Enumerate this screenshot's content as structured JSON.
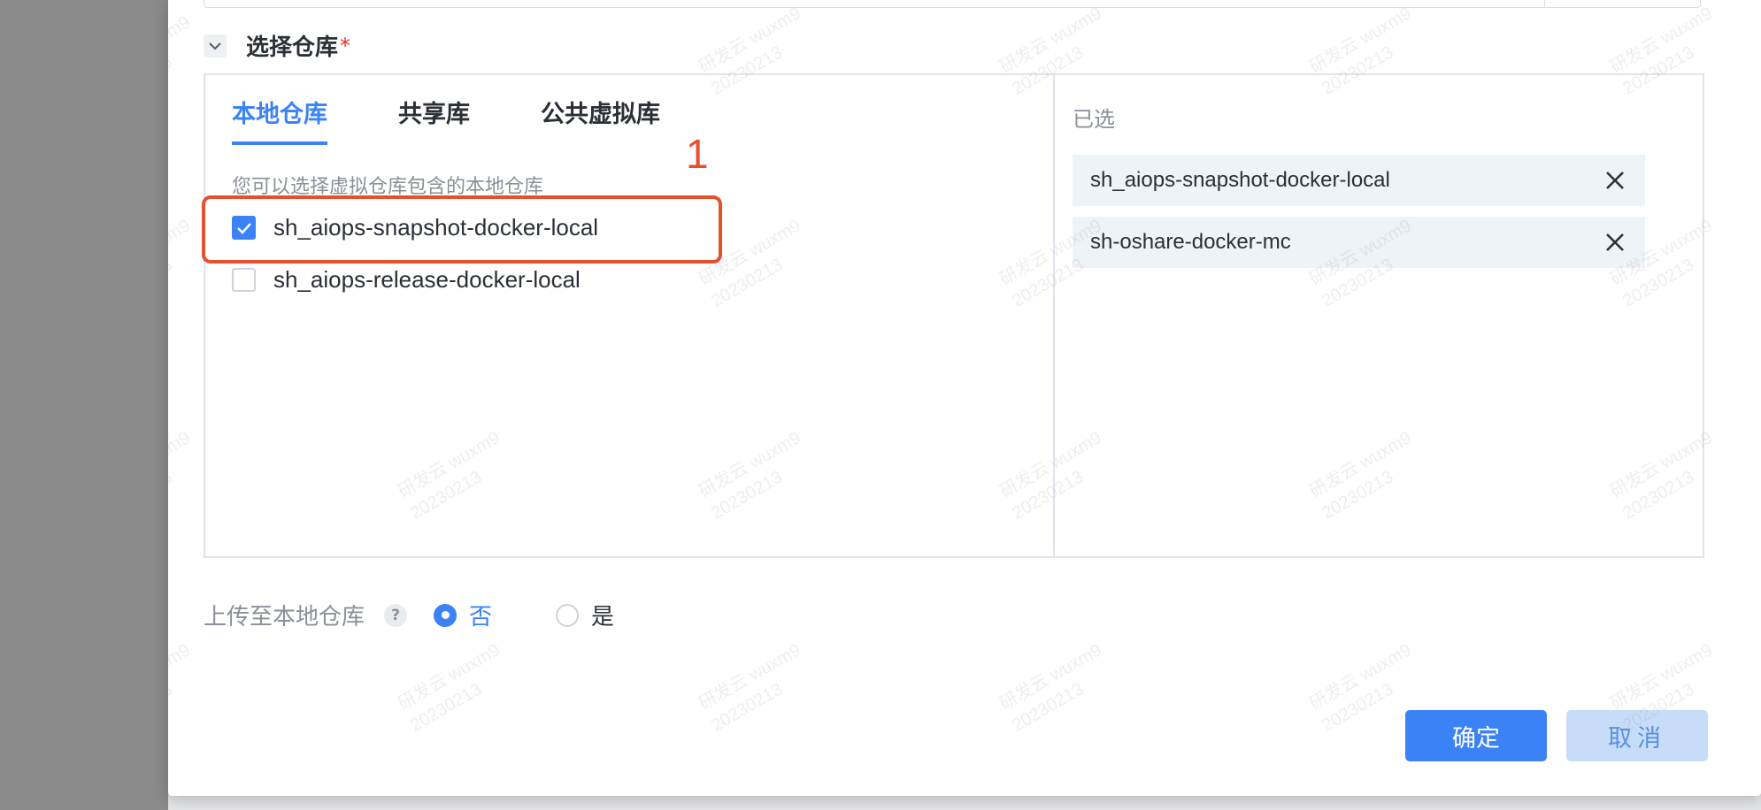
{
  "section": {
    "title": "选择仓库",
    "required_mark": "*"
  },
  "tabs": [
    {
      "label": "本地仓库",
      "active": true
    },
    {
      "label": "共享库",
      "active": false
    },
    {
      "label": "公共虚拟库",
      "active": false
    }
  ],
  "hint": "您可以选择虚拟仓库包含的本地仓库",
  "annotation": {
    "number": "1",
    "color": "#e5502d"
  },
  "local_repos": [
    {
      "label": "sh_aiops-snapshot-docker-local",
      "checked": true
    },
    {
      "label": "sh_aiops-release-docker-local",
      "checked": false
    }
  ],
  "selected": {
    "title": "已选",
    "items": [
      {
        "label": "sh_aiops-snapshot-docker-local"
      },
      {
        "label": "sh-oshare-docker-mc"
      }
    ]
  },
  "upload": {
    "label": "上传至本地仓库",
    "help_icon": "question-icon",
    "options": [
      {
        "label": "否",
        "selected": true
      },
      {
        "label": "是",
        "selected": false
      }
    ]
  },
  "buttons": {
    "ok": "确定",
    "cancel": "取消"
  },
  "watermark": {
    "line1": "研发云 wuxm9",
    "line2": "20230213"
  },
  "colors": {
    "accent": "#3b82f6",
    "required": "#e5322d"
  }
}
